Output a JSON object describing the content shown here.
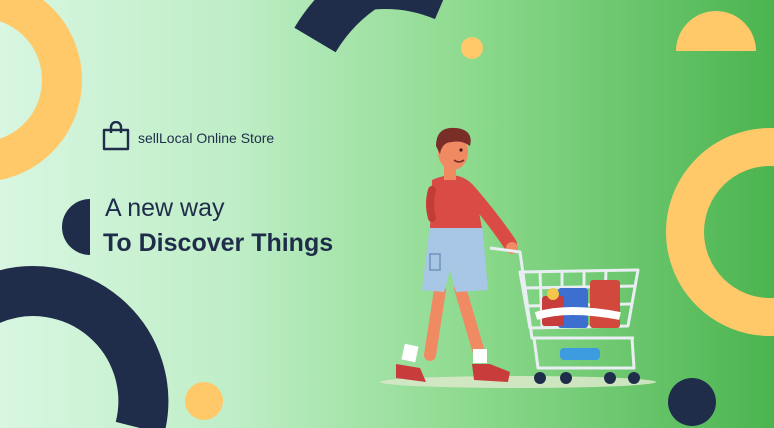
{
  "brand": {
    "name": "sellLocal Online Store",
    "icon": "shopping-bag-icon"
  },
  "hero": {
    "tagline": "A new way",
    "headline": "To Discover Things"
  },
  "colors": {
    "navy": "#1f2d4b",
    "yellow": "#ffc96a",
    "green_light": "#d8f6e1",
    "green_dark": "#4bb44f"
  }
}
